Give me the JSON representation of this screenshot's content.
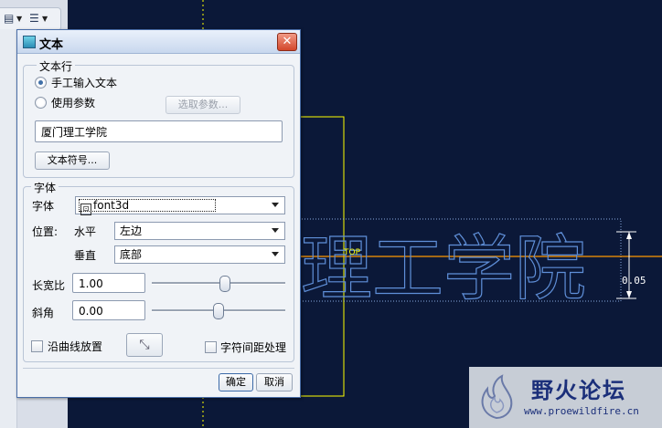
{
  "dialog": {
    "title": "文本",
    "close": "✕",
    "text_line": {
      "legend": "文本行",
      "manual_label": "手工输入文本",
      "param_label": "使用参数",
      "select_param_button": "选取参数...",
      "text_value": "厦门理工学院",
      "symbol_button": "文本符号..."
    },
    "font": {
      "legend": "字体",
      "font_label": "字体",
      "font_value": "font3d",
      "position_label": "位置:",
      "horizontal_label": "水平",
      "horizontal_value": "左边",
      "vertical_label": "垂直",
      "vertical_value": "底部",
      "aspect_label": "长宽比",
      "aspect_value": "1.00",
      "aspect_level": 0.55,
      "slant_label": "斜角",
      "slant_value": "0.00",
      "slant_level": 0.5,
      "curve_label": "沿曲线放置",
      "spacing_label": "字符间距处理"
    },
    "ok_button": "确定",
    "cancel_button": "取消"
  },
  "canvas": {
    "outline_text": "理工学院",
    "top_label": "TOP",
    "dimension_value": "0.05",
    "colors": {
      "background": "#0b1838",
      "outline": "#5f8fd8",
      "yellow": "#ffff00",
      "orange": "#ff9900"
    }
  },
  "watermark": {
    "name": "野火论坛",
    "url": "www.proewildfire.cn"
  }
}
